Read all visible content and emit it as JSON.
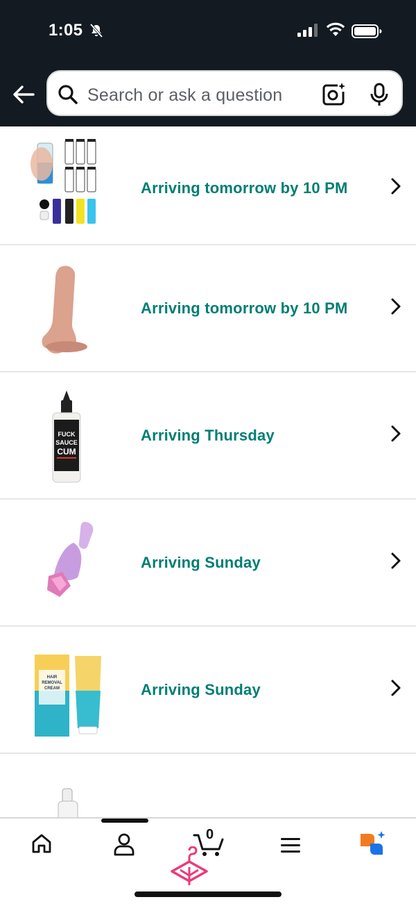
{
  "status_bar": {
    "time": "1:05",
    "icons": [
      "bell-off-icon",
      "signal-icon",
      "wifi-icon",
      "battery-icon"
    ]
  },
  "search": {
    "placeholder": "Search or ask a question",
    "icons": [
      "back-arrow-icon",
      "search-icon",
      "camera-lens-icon",
      "mic-icon"
    ]
  },
  "orders": [
    {
      "status": "Arriving tomorrow by 10 PM",
      "thumbnail": "clear plastic vials set"
    },
    {
      "status": "Arriving tomorrow by 10 PM",
      "thumbnail": "flesh-colored product"
    },
    {
      "status": "Arriving Thursday",
      "thumbnail": "black lubricant bottle"
    },
    {
      "status": "Arriving Sunday",
      "thumbnail": "pink glass product"
    },
    {
      "status": "Arriving Sunday",
      "thumbnail": "hair removal cream box and tube"
    }
  ],
  "product_label": {
    "bottle_lines": [
      "FUCK",
      "SAUCE",
      "CUM"
    ],
    "cream_lines": [
      "HAIR",
      "REMOVAL",
      "CREAM"
    ]
  },
  "bottom_nav": {
    "cart_count": "0",
    "items": [
      "home-icon",
      "account-icon",
      "cart-icon",
      "menu-icon",
      "assistant-icon"
    ]
  },
  "colors": {
    "header_bg": "#131a22",
    "status_text": "#007e73",
    "assistant_orange": "#f37b1f",
    "assistant_blue": "#1a73e8",
    "hanger_pink": "#ec3a78"
  }
}
